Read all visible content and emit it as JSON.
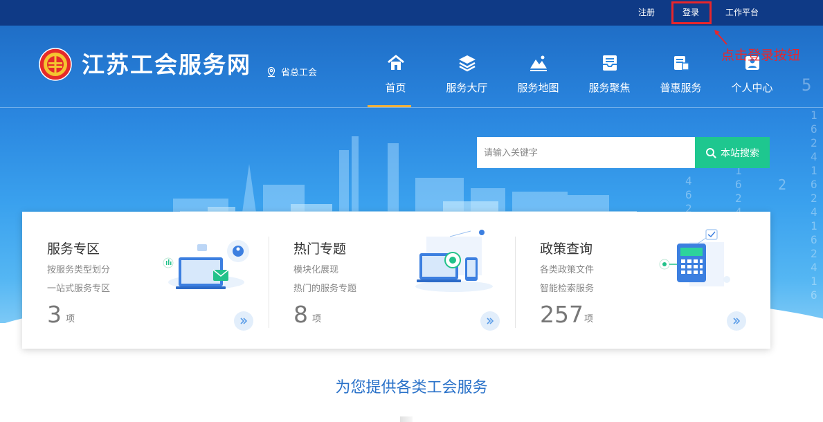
{
  "topbar": {
    "register": "注册",
    "login": "登录",
    "workbench": "工作平台"
  },
  "header": {
    "site_name": "江苏工会服务网",
    "province_label": "省总工会",
    "logo_icon": "union-emblem-icon",
    "province_icon": "location-icon"
  },
  "nav": {
    "items": [
      {
        "label": "首页",
        "icon": "home-icon",
        "active": true
      },
      {
        "label": "服务大厅",
        "icon": "layers-icon"
      },
      {
        "label": "服务地图",
        "icon": "map-icon"
      },
      {
        "label": "服务聚焦",
        "icon": "inbox-icon"
      },
      {
        "label": "普惠服务",
        "icon": "bank-icon"
      },
      {
        "label": "个人中心",
        "icon": "user-icon"
      }
    ]
  },
  "annotation": {
    "text": "点击登录按钮"
  },
  "search": {
    "placeholder": "请输入关键字",
    "button_label": "本站搜索",
    "icon": "search-icon"
  },
  "cards": [
    {
      "title": "服务专区",
      "desc1": "按服务类型划分",
      "desc2": "一站式服务专区",
      "count": "3",
      "unit": "项",
      "illustration": "laptop-mail-icon"
    },
    {
      "title": "热门专题",
      "desc1": "模块化展现",
      "desc2": "热门的服务专题",
      "count": "8",
      "unit": "项",
      "illustration": "devices-icon"
    },
    {
      "title": "政策查询",
      "desc1": "各类政策文件",
      "desc2": "智能检索服务",
      "count": "257",
      "unit": "项",
      "illustration": "calculator-icon"
    }
  ],
  "section": {
    "title": "为您提供各类工会服务"
  },
  "colors": {
    "topbar": "#0f3a86",
    "accent": "#1ec78f",
    "active_underline": "#f2b13a",
    "highlight": "#e8262b"
  }
}
